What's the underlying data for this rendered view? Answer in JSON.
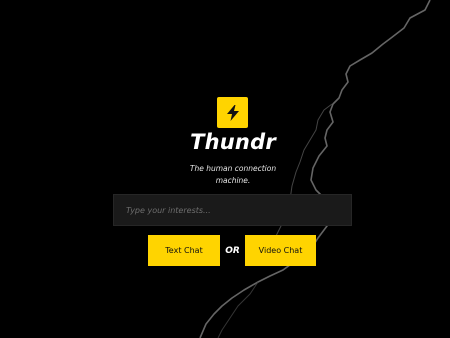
{
  "brand": {
    "name": "Thundr",
    "tagline": "The human connection machine.",
    "logo_icon": "lightning-bolt-icon"
  },
  "search": {
    "placeholder": "Type your interests...",
    "value": ""
  },
  "actions": {
    "text_chat_label": "Text Chat",
    "or_label": "OR",
    "video_chat_label": "Video Chat"
  },
  "colors": {
    "background": "#000000",
    "accent": "#FFD400",
    "input_bg": "#1a1a1a",
    "text": "#ffffff"
  }
}
